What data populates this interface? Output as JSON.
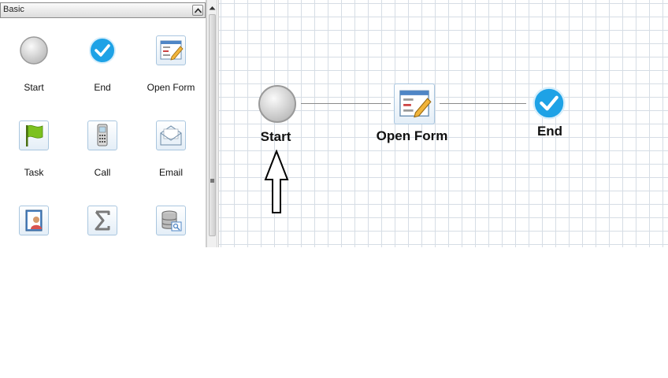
{
  "toolbox": {
    "title": "Basic",
    "items": [
      {
        "label": "Start",
        "icon": "start-circle-icon"
      },
      {
        "label": "End",
        "icon": "end-check-icon"
      },
      {
        "label": "Open Form",
        "icon": "form-edit-icon"
      },
      {
        "label": "Task",
        "icon": "flag-icon"
      },
      {
        "label": "Call",
        "icon": "phone-icon"
      },
      {
        "label": "Email",
        "icon": "envelope-icon"
      },
      {
        "label": "",
        "icon": "contact-book-icon"
      },
      {
        "label": "",
        "icon": "sigma-icon"
      },
      {
        "label": "",
        "icon": "database-search-icon"
      }
    ]
  },
  "canvas": {
    "nodes": [
      {
        "label": "Start",
        "icon": "start-circle-icon"
      },
      {
        "label": "Open Form",
        "icon": "form-edit-icon"
      },
      {
        "label": "End",
        "icon": "end-check-icon"
      }
    ]
  },
  "colors": {
    "check_blue": "#1ea2e6",
    "grid_line": "#d6dde5",
    "flag_green": "#7cc11f"
  }
}
